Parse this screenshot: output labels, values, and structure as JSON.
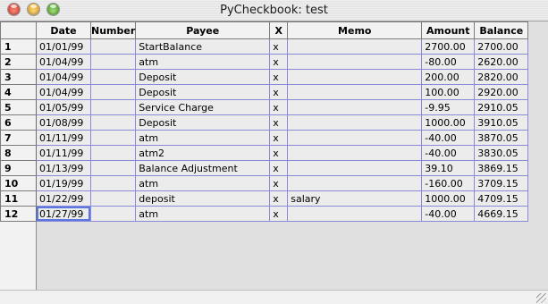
{
  "window": {
    "title": "PyCheckbook: test",
    "colors": {
      "grid_line": "#8a8ad8",
      "selection": "#5a78e0",
      "cell_bg": "#ececec"
    }
  },
  "background": {
    "partial_text": "~~~ ~~ ~~~"
  },
  "table": {
    "headers": [
      "Date",
      "Number",
      "Payee",
      "X",
      "Memo",
      "Amount",
      "Balance"
    ],
    "rows": [
      {
        "n": "1",
        "date": "01/01/99",
        "number": "",
        "payee": "StartBalance",
        "x": "x",
        "memo": "",
        "amount": "2700.00",
        "balance": "2700.00"
      },
      {
        "n": "2",
        "date": "01/04/99",
        "number": "",
        "payee": "atm",
        "x": "x",
        "memo": "",
        "amount": "-80.00",
        "balance": "2620.00"
      },
      {
        "n": "3",
        "date": "01/04/99",
        "number": "",
        "payee": "Deposit",
        "x": "x",
        "memo": "",
        "amount": "200.00",
        "balance": "2820.00"
      },
      {
        "n": "4",
        "date": "01/04/99",
        "number": "",
        "payee": "Deposit",
        "x": "x",
        "memo": "",
        "amount": "100.00",
        "balance": "2920.00"
      },
      {
        "n": "5",
        "date": "01/05/99",
        "number": "",
        "payee": "Service Charge",
        "x": "x",
        "memo": "",
        "amount": "-9.95",
        "balance": "2910.05"
      },
      {
        "n": "6",
        "date": "01/08/99",
        "number": "",
        "payee": "Deposit",
        "x": "x",
        "memo": "",
        "amount": "1000.00",
        "balance": "3910.05"
      },
      {
        "n": "7",
        "date": "01/11/99",
        "number": "",
        "payee": "atm",
        "x": "x",
        "memo": "",
        "amount": "-40.00",
        "balance": "3870.05"
      },
      {
        "n": "8",
        "date": "01/11/99",
        "number": "",
        "payee": "atm2",
        "x": "x",
        "memo": "",
        "amount": "-40.00",
        "balance": "3830.05"
      },
      {
        "n": "9",
        "date": "01/13/99",
        "number": "",
        "payee": "Balance Adjustment",
        "x": "x",
        "memo": "",
        "amount": "39.10",
        "balance": "3869.15"
      },
      {
        "n": "10",
        "date": "01/19/99",
        "number": "",
        "payee": "atm",
        "x": "x",
        "memo": "",
        "amount": "-160.00",
        "balance": "3709.15"
      },
      {
        "n": "11",
        "date": "01/22/99",
        "number": "",
        "payee": "deposit",
        "x": "x",
        "memo": "salary",
        "amount": "1000.00",
        "balance": "4709.15"
      },
      {
        "n": "12",
        "date": "01/27/99",
        "number": "",
        "payee": "atm",
        "x": "x",
        "memo": "",
        "amount": "-40.00",
        "balance": "4669.15"
      }
    ]
  }
}
